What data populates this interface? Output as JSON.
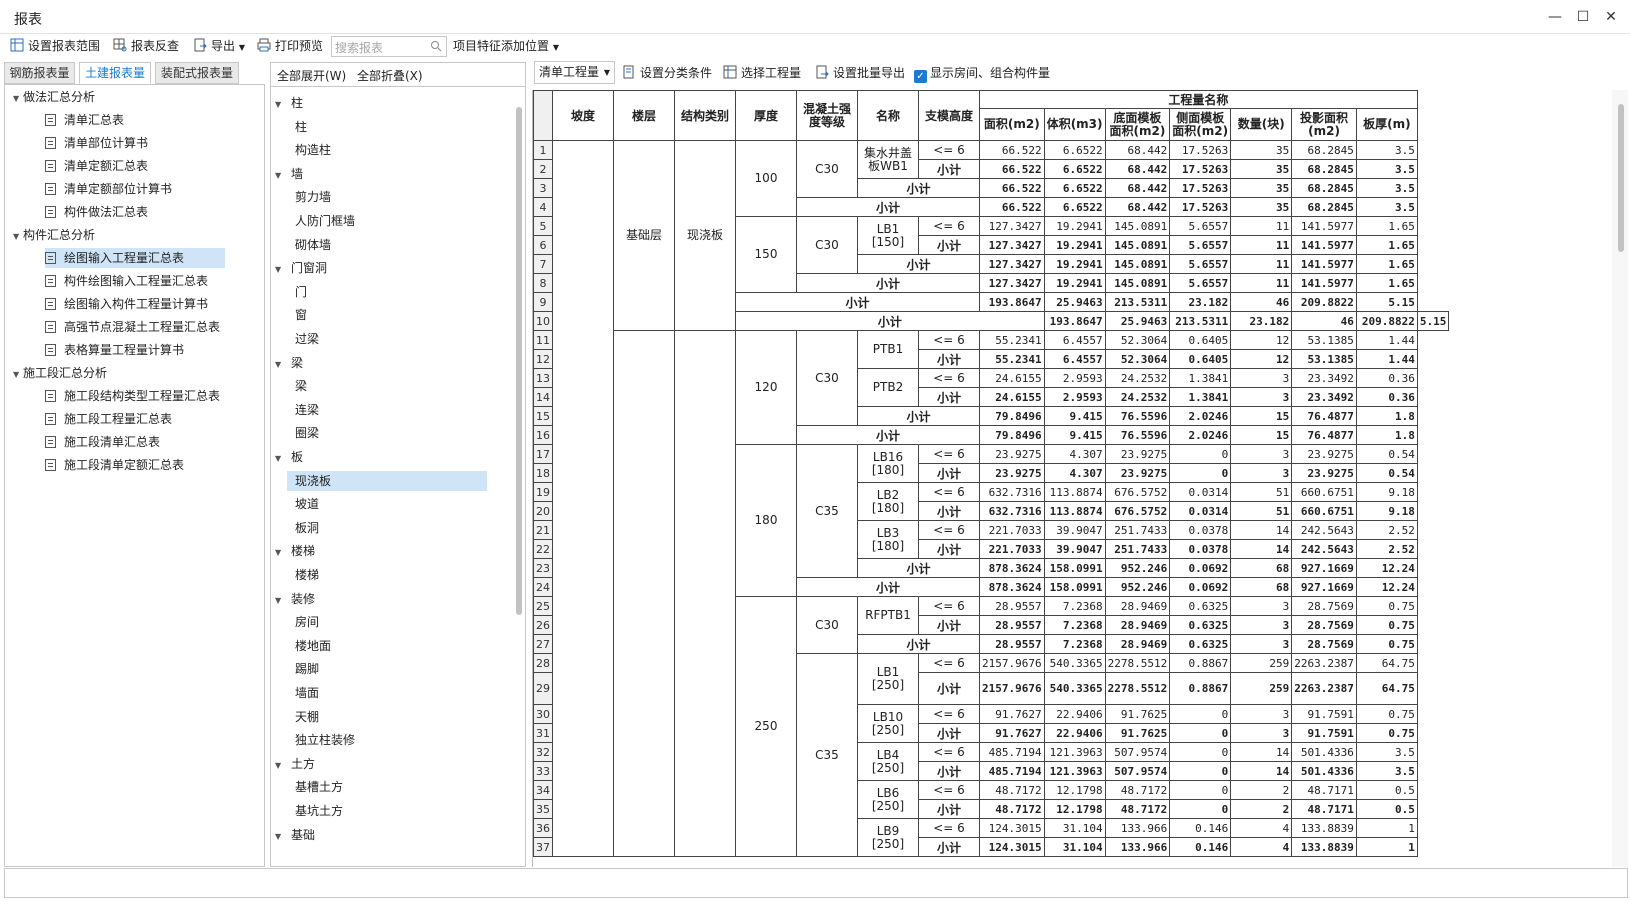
{
  "window": {
    "title": "报表",
    "min": "—",
    "max": "☐",
    "close": "✕"
  },
  "toolbar": {
    "set_range": "设置报表范围",
    "review": "报表反查",
    "export": "导出",
    "print_preview": "打印预览",
    "search_placeholder": "搜索报表",
    "add_feature": "项目特征添加位置"
  },
  "tabs": [
    "钢筋报表量",
    "土建报表量",
    "装配式报表量"
  ],
  "report_tree": [
    {
      "label": "做法汇总分析",
      "level": 0
    },
    {
      "label": "清单汇总表",
      "level": 1
    },
    {
      "label": "清单部位计算书",
      "level": 1
    },
    {
      "label": "清单定额汇总表",
      "level": 1
    },
    {
      "label": "清单定额部位计算书",
      "level": 1
    },
    {
      "label": "构件做法汇总表",
      "level": 1
    },
    {
      "label": "构件汇总分析",
      "level": 0
    },
    {
      "label": "绘图输入工程量汇总表",
      "level": 1,
      "selected": true
    },
    {
      "label": "构件绘图输入工程量汇总表",
      "level": 1
    },
    {
      "label": "绘图输入构件工程量计算书",
      "level": 1
    },
    {
      "label": "高强节点混凝土工程量汇总表",
      "level": 1
    },
    {
      "label": "表格算量工程量计算书",
      "level": 1
    },
    {
      "label": "施工段汇总分析",
      "level": 0
    },
    {
      "label": "施工段结构类型工程量汇总表",
      "level": 1
    },
    {
      "label": "施工段工程量汇总表",
      "level": 1
    },
    {
      "label": "施工段清单汇总表",
      "level": 1
    },
    {
      "label": "施工段清单定额汇总表",
      "level": 1
    }
  ],
  "component_panel": {
    "expand_all": "全部展开(W)",
    "collapse_all": "全部折叠(X)",
    "items": [
      {
        "label": "柱",
        "level": 0
      },
      {
        "label": "柱",
        "level": 1
      },
      {
        "label": "构造柱",
        "level": 1
      },
      {
        "label": "墙",
        "level": 0
      },
      {
        "label": "剪力墙",
        "level": 1
      },
      {
        "label": "人防门框墙",
        "level": 1
      },
      {
        "label": "砌体墙",
        "level": 1
      },
      {
        "label": "门窗洞",
        "level": 0
      },
      {
        "label": "门",
        "level": 1
      },
      {
        "label": "窗",
        "level": 1
      },
      {
        "label": "过梁",
        "level": 1
      },
      {
        "label": "梁",
        "level": 0
      },
      {
        "label": "梁",
        "level": 1
      },
      {
        "label": "连梁",
        "level": 1
      },
      {
        "label": "圈梁",
        "level": 1
      },
      {
        "label": "板",
        "level": 0
      },
      {
        "label": "现浇板",
        "level": 1,
        "selected": true
      },
      {
        "label": "坡道",
        "level": 1
      },
      {
        "label": "板洞",
        "level": 1
      },
      {
        "label": "楼梯",
        "level": 0
      },
      {
        "label": "楼梯",
        "level": 1
      },
      {
        "label": "装修",
        "level": 0
      },
      {
        "label": "房间",
        "level": 1
      },
      {
        "label": "楼地面",
        "level": 1
      },
      {
        "label": "踢脚",
        "level": 1
      },
      {
        "label": "墙面",
        "level": 1
      },
      {
        "label": "天棚",
        "level": 1
      },
      {
        "label": "独立柱装修",
        "level": 1
      },
      {
        "label": "土方",
        "level": 0
      },
      {
        "label": "基槽土方",
        "level": 1
      },
      {
        "label": "基坑土方",
        "level": 1
      },
      {
        "label": "基础",
        "level": 0
      }
    ]
  },
  "report_toolbar": {
    "dropdown": "清单工程量",
    "set_category": "设置分类条件",
    "select_qty": "选择工程量",
    "batch_export": "设置批量导出",
    "show_room": "显示房间、组合构件量"
  },
  "table": {
    "headers": {
      "slope": "坡度",
      "floor": "楼层",
      "struct": "结构类别",
      "thick": "厚度",
      "grade": "混凝土强度等级",
      "name": "名称",
      "support": "支模高度",
      "qty_name": "工程量名称",
      "area": "面积(m2)",
      "volume": "体积(m3)",
      "bottom": "底面模板面积(m2)",
      "side": "侧面模板面积(m2)",
      "count": "数量(块)",
      "proj": "投影面积(m2)",
      "thk": "板厚(m)"
    },
    "labels": {
      "floor": "基础层",
      "struct": "现浇板",
      "subtotal": "小计",
      "le6": "<= 6",
      "t100": "100",
      "t150": "150",
      "t120": "120",
      "t180": "180",
      "t250": "250",
      "c30": "C30",
      "c35": "C35",
      "n1": "集水井盖板WB1",
      "n2": "LB1 [150]",
      "n3": "PTB1",
      "n4": "PTB2",
      "n5": "LB16 [180]",
      "n6": "LB2 [180]",
      "n7": "LB3 [180]",
      "n8": "RFPTB1",
      "n9": "LB1 [250]",
      "n10": "LB10 [250]",
      "n11": "LB4 [250]",
      "n12": "LB6 [250]",
      "n13": "LB9 [250]"
    },
    "rows": [
      [
        "66.522",
        "6.6522",
        "68.442",
        "17.5263",
        "35",
        "68.2845",
        "3.5"
      ],
      [
        "66.522",
        "6.6522",
        "68.442",
        "17.5263",
        "35",
        "68.2845",
        "3.5"
      ],
      [
        "66.522",
        "6.6522",
        "68.442",
        "17.5263",
        "35",
        "68.2845",
        "3.5"
      ],
      [
        "66.522",
        "6.6522",
        "68.442",
        "17.5263",
        "35",
        "68.2845",
        "3.5"
      ],
      [
        "127.3427",
        "19.2941",
        "145.0891",
        "5.6557",
        "11",
        "141.5977",
        "1.65"
      ],
      [
        "127.3427",
        "19.2941",
        "145.0891",
        "5.6557",
        "11",
        "141.5977",
        "1.65"
      ],
      [
        "127.3427",
        "19.2941",
        "145.0891",
        "5.6557",
        "11",
        "141.5977",
        "1.65"
      ],
      [
        "127.3427",
        "19.2941",
        "145.0891",
        "5.6557",
        "11",
        "141.5977",
        "1.65"
      ],
      [
        "193.8647",
        "25.9463",
        "213.5311",
        "23.182",
        "46",
        "209.8822",
        "5.15"
      ],
      [
        "193.8647",
        "25.9463",
        "213.5311",
        "23.182",
        "46",
        "209.8822",
        "5.15"
      ],
      [
        "55.2341",
        "6.4557",
        "52.3064",
        "0.6405",
        "12",
        "53.1385",
        "1.44"
      ],
      [
        "55.2341",
        "6.4557",
        "52.3064",
        "0.6405",
        "12",
        "53.1385",
        "1.44"
      ],
      [
        "24.6155",
        "2.9593",
        "24.2532",
        "1.3841",
        "3",
        "23.3492",
        "0.36"
      ],
      [
        "24.6155",
        "2.9593",
        "24.2532",
        "1.3841",
        "3",
        "23.3492",
        "0.36"
      ],
      [
        "79.8496",
        "9.415",
        "76.5596",
        "2.0246",
        "15",
        "76.4877",
        "1.8"
      ],
      [
        "79.8496",
        "9.415",
        "76.5596",
        "2.0246",
        "15",
        "76.4877",
        "1.8"
      ],
      [
        "23.9275",
        "4.307",
        "23.9275",
        "0",
        "3",
        "23.9275",
        "0.54"
      ],
      [
        "23.9275",
        "4.307",
        "23.9275",
        "0",
        "3",
        "23.9275",
        "0.54"
      ],
      [
        "632.7316",
        "113.8874",
        "676.5752",
        "0.0314",
        "51",
        "660.6751",
        "9.18"
      ],
      [
        "632.7316",
        "113.8874",
        "676.5752",
        "0.0314",
        "51",
        "660.6751",
        "9.18"
      ],
      [
        "221.7033",
        "39.9047",
        "251.7433",
        "0.0378",
        "14",
        "242.5643",
        "2.52"
      ],
      [
        "221.7033",
        "39.9047",
        "251.7433",
        "0.0378",
        "14",
        "242.5643",
        "2.52"
      ],
      [
        "878.3624",
        "158.0991",
        "952.246",
        "0.0692",
        "68",
        "927.1669",
        "12.24"
      ],
      [
        "878.3624",
        "158.0991",
        "952.246",
        "0.0692",
        "68",
        "927.1669",
        "12.24"
      ],
      [
        "28.9557",
        "7.2368",
        "28.9469",
        "0.6325",
        "3",
        "28.7569",
        "0.75"
      ],
      [
        "28.9557",
        "7.2368",
        "28.9469",
        "0.6325",
        "3",
        "28.7569",
        "0.75"
      ],
      [
        "28.9557",
        "7.2368",
        "28.9469",
        "0.6325",
        "3",
        "28.7569",
        "0.75"
      ],
      [
        "2157.9676",
        "540.3365",
        "2278.5512",
        "0.8867",
        "259",
        "2263.2387",
        "64.75"
      ],
      [
        "2157.9676",
        "540.3365",
        "2278.5512",
        "0.8867",
        "259",
        "2263.2387",
        "64.75"
      ],
      [
        "91.7627",
        "22.9406",
        "91.7625",
        "0",
        "3",
        "91.7591",
        "0.75"
      ],
      [
        "91.7627",
        "22.9406",
        "91.7625",
        "0",
        "3",
        "91.7591",
        "0.75"
      ],
      [
        "485.7194",
        "121.3963",
        "507.9574",
        "0",
        "14",
        "501.4336",
        "3.5"
      ],
      [
        "485.7194",
        "121.3963",
        "507.9574",
        "0",
        "14",
        "501.4336",
        "3.5"
      ],
      [
        "48.7172",
        "12.1798",
        "48.7172",
        "0",
        "2",
        "48.7171",
        "0.5"
      ],
      [
        "48.7172",
        "12.1798",
        "48.7172",
        "0",
        "2",
        "48.7171",
        "0.5"
      ],
      [
        "124.3015",
        "31.104",
        "133.966",
        "0.146",
        "4",
        "133.8839",
        "1"
      ],
      [
        "124.3015",
        "31.104",
        "133.966",
        "0.146",
        "4",
        "133.8839",
        "1"
      ]
    ],
    "row_numbers": [
      "1",
      "2",
      "3",
      "4",
      "5",
      "6",
      "7",
      "8",
      "9",
      "10",
      "11",
      "12",
      "13",
      "14",
      "15",
      "16",
      "17",
      "18",
      "19",
      "20",
      "21",
      "22",
      "23",
      "24",
      "25",
      "26",
      "27",
      "28",
      "29",
      "30",
      "31",
      "32",
      "33",
      "34",
      "35",
      "36",
      "37"
    ]
  },
  "colors": {
    "accent": "#1a7bd0",
    "selection": "#cfe4f7"
  }
}
